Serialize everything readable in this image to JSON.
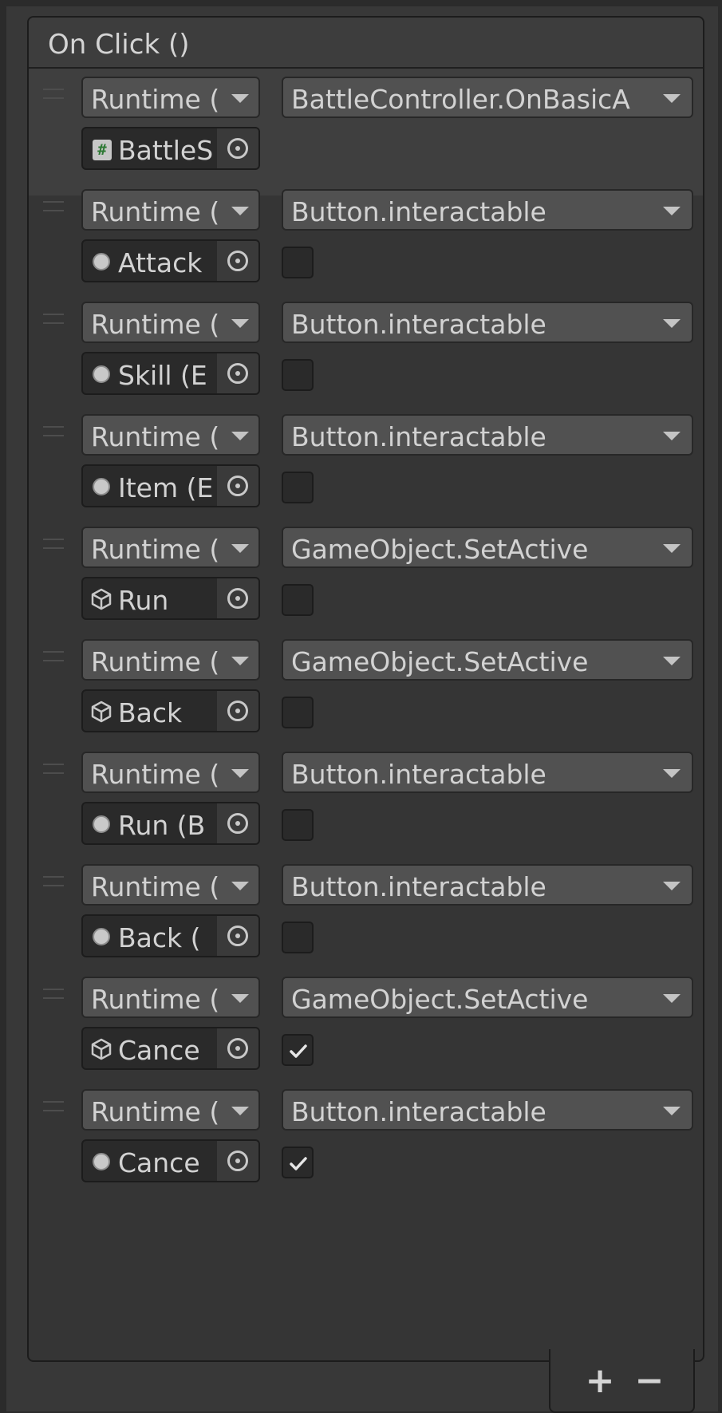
{
  "event": {
    "title": "On Click ()"
  },
  "entries": [
    {
      "runtime": "Runtime (",
      "function": "BattleController.OnBasicA",
      "object": "BattleS",
      "object_icon": "script-icon",
      "checkbox": null,
      "selected": true
    },
    {
      "runtime": "Runtime (",
      "function": "Button.interactable",
      "object": "Attack",
      "object_icon": "circle-icon",
      "checkbox": false
    },
    {
      "runtime": "Runtime (",
      "function": "Button.interactable",
      "object": "Skill (E",
      "object_icon": "circle-icon",
      "checkbox": false
    },
    {
      "runtime": "Runtime (",
      "function": "Button.interactable",
      "object": "Item (E",
      "object_icon": "circle-icon",
      "checkbox": false
    },
    {
      "runtime": "Runtime (",
      "function": "GameObject.SetActive",
      "object": "Run",
      "object_icon": "cube-icon",
      "checkbox": false
    },
    {
      "runtime": "Runtime (",
      "function": "GameObject.SetActive",
      "object": "Back",
      "object_icon": "cube-icon",
      "checkbox": false
    },
    {
      "runtime": "Runtime (",
      "function": "Button.interactable",
      "object": "Run (B",
      "object_icon": "circle-icon",
      "checkbox": false
    },
    {
      "runtime": "Runtime (",
      "function": "Button.interactable",
      "object": "Back (",
      "object_icon": "circle-icon",
      "checkbox": false
    },
    {
      "runtime": "Runtime (",
      "function": "GameObject.SetActive",
      "object": "Cance",
      "object_icon": "cube-icon",
      "checkbox": true
    },
    {
      "runtime": "Runtime (",
      "function": "Button.interactable",
      "object": "Cance",
      "object_icon": "circle-icon",
      "checkbox": true
    }
  ],
  "footer": {
    "add_label": "+",
    "remove_label": "−"
  },
  "colors": {
    "background": "#2b2b2b",
    "dropdown": "#515151",
    "field": "#2a2a2a",
    "text": "#d2d2d2",
    "script_icon_accent": "#2f7a36"
  }
}
